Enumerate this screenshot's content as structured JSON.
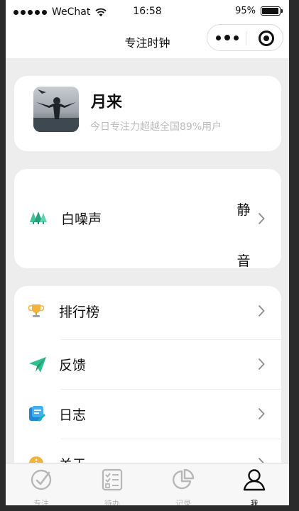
{
  "status_bar": {
    "carrier": "WeChat",
    "time": "16:58",
    "battery_text": "95%",
    "battery_level": 0.95
  },
  "nav": {
    "title": "专注时钟"
  },
  "profile": {
    "name": "月来",
    "subtitle": "今日专注力超越全国89%用户"
  },
  "white_noise": {
    "icon": "forest-icon",
    "label": "白噪声",
    "value": "静音"
  },
  "menu": [
    {
      "icon": "trophy-icon",
      "label": "排行榜"
    },
    {
      "icon": "paper-plane-icon",
      "label": "反馈"
    },
    {
      "icon": "journal-icon",
      "label": "日志"
    },
    {
      "icon": "info-icon",
      "label": "关于"
    }
  ],
  "tabbar": [
    {
      "icon": "focus-target-icon",
      "label": "专注",
      "active": false
    },
    {
      "icon": "checklist-icon",
      "label": "待办",
      "active": false
    },
    {
      "icon": "pie-chart-icon",
      "label": "记录",
      "active": false
    },
    {
      "icon": "user-icon",
      "label": "我",
      "active": true
    }
  ],
  "colors": {
    "accent_green": "#2fbf8f",
    "page_background": "#ededed",
    "muted_text": "#bcbcbc",
    "tab_inactive": "#b7b7b7"
  }
}
